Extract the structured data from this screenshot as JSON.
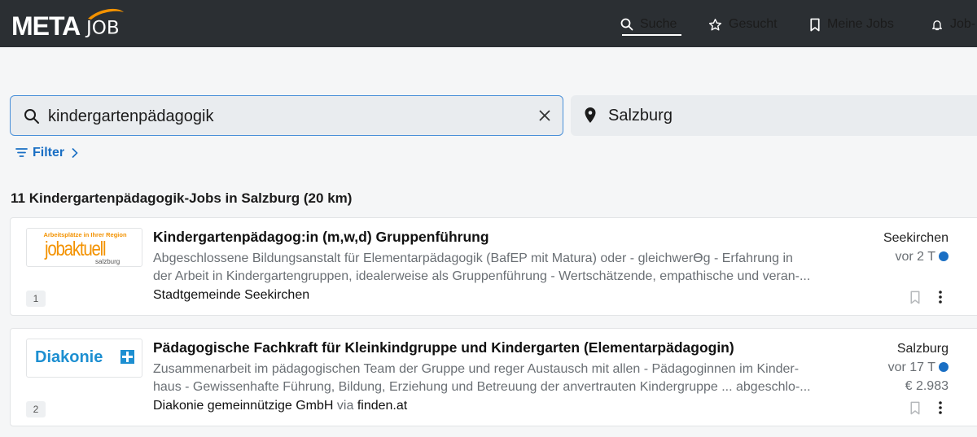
{
  "header": {
    "logo_meta": "META",
    "logo_job": "JOB",
    "nav": [
      {
        "label": "Suche",
        "icon": "search-icon"
      },
      {
        "label": "Gesucht",
        "icon": "star-icon"
      },
      {
        "label": "Meine Jobs",
        "icon": "bookmark-icon"
      },
      {
        "label": "Job-",
        "icon": "bell-icon"
      }
    ],
    "active": "Suche"
  },
  "search": {
    "query": "kindergartenpädagogik",
    "location": "Salzburg"
  },
  "filter_label": "Filter",
  "result_count": "11 Kindergartenpädagogik-Jobs in Salzburg (20 km)",
  "jobs": [
    {
      "rank": "1",
      "logo_text": "jobaktuell",
      "logo_top": "Arbeitsplätze in Ihrer Region",
      "logo_sub": "salzburg",
      "title_bold": "Kindergartenpädagog",
      "title_rest": ":in (m,w,d) Gruppenführung",
      "snippet": [
        "Abgeschlossene Bildungsanstalt für Elementarpädagogik (BafEP mit Matura) oder - gleichwerϴg - Erfahrung in",
        "der Arbeit in Kindergartengruppen, idealerweise als Gruppenführung - Wertschätzende, empathische und veran-..."
      ],
      "company": "Stadtgemeinde Seekirchen",
      "via": "",
      "source": "",
      "city": "Seekirchen",
      "age": "vor 2 T",
      "salary": ""
    },
    {
      "rank": "2",
      "logo_text": "Diakonie",
      "title_bold": "",
      "title_rest": "Pädagogische Fachkraft für Kleinkindgruppe und Kindergarten (Elementarpädagogin)",
      "snippet": [
        "Zusammenarbeit im pädagogischen Team der Gruppe und reger Austausch mit allen - Pädagoginnen im Kinder-",
        "haus - Gewissenhafte Führung, Bildung, Erziehung und Betreuung der anvertrauten Kindergruppe ... abgeschlo-..."
      ],
      "company": "Diakonie gemeinnützige GmbH",
      "via": "via",
      "source": "finden.at",
      "city": "Salzburg",
      "age": "vor 17 T",
      "salary": "€ 2.983"
    }
  ],
  "colors": {
    "topbar": "#2b2f33",
    "accent": "#1a6fc4",
    "logo_orange": "#f39200",
    "diakonie_blue": "#1d8fd1"
  }
}
